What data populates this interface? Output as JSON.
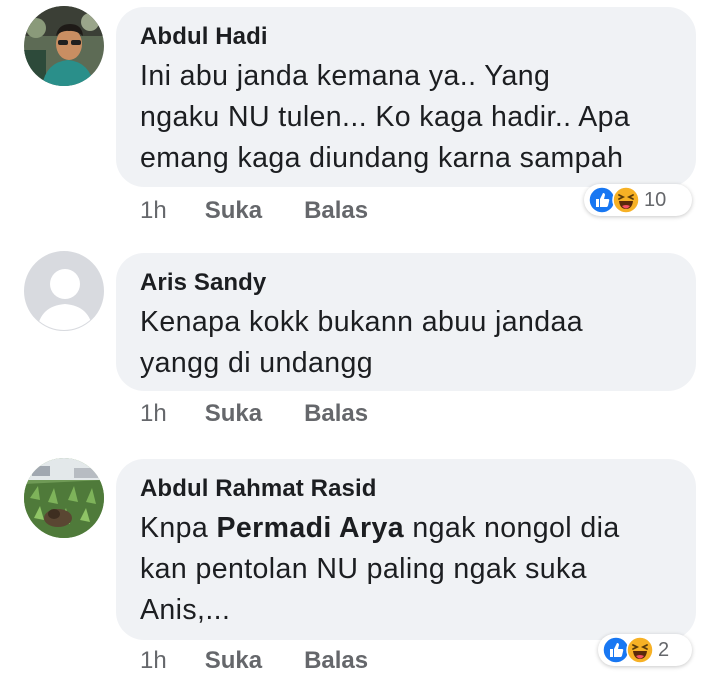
{
  "colors": {
    "bubble_bg": "#f0f2f5",
    "text": "#1c1e21",
    "meta": "#65676b",
    "like_blue": "#1877f2",
    "haha_yellow": "#f7b125"
  },
  "comments": [
    {
      "author": "Abdul Hadi",
      "text_lines": [
        "Ini abu janda kemana ya.. Yang",
        "ngaku NU tulen... Ko kaga hadir.. Apa",
        "emang kaga diundang karna sampah"
      ],
      "time": "1h",
      "like_label": "Suka",
      "reply_label": "Balas",
      "reactions": {
        "icons": [
          "like-icon",
          "haha-icon"
        ],
        "count": "10"
      }
    },
    {
      "author": "Aris Sandy",
      "text_lines": [
        "Kenapa kokk bukann abuu jandaa",
        "yangg di undangg"
      ],
      "time": "1h",
      "like_label": "Suka",
      "reply_label": "Balas"
    },
    {
      "author": "Abdul Rahmat Rasid",
      "text_prefix": "Knpa ",
      "mention": "Permadi Arya",
      "text_suffix": " ngak nongol dia",
      "text_lines_rest": [
        "kan pentolan NU paling ngak suka",
        "Anis,..."
      ],
      "time": "1h",
      "like_label": "Suka",
      "reply_label": "Balas",
      "reactions": {
        "icons": [
          "like-icon",
          "haha-icon"
        ],
        "count": "2"
      }
    }
  ]
}
